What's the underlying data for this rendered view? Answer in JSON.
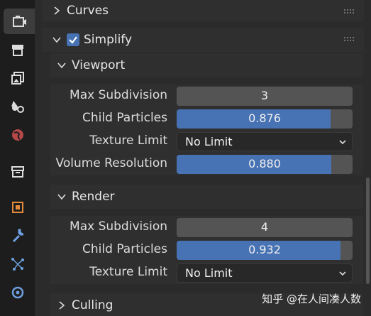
{
  "tabs": [
    {
      "name": "render-properties-tab",
      "active": true
    },
    {
      "name": "output-properties-tab"
    },
    {
      "name": "view-layer-tab"
    },
    {
      "name": "scene-tab"
    },
    {
      "name": "world-tab"
    },
    {
      "name": "collection-tab"
    },
    {
      "name": "object-tab"
    },
    {
      "name": "modifiers-tab"
    },
    {
      "name": "particles-tab"
    },
    {
      "name": "physics-tab"
    }
  ],
  "panels": {
    "curves": {
      "title": "Curves"
    },
    "simplify": {
      "title": "Simplify",
      "enabled": true
    },
    "viewport": {
      "title": "Viewport",
      "max_subdivision": {
        "label": "Max Subdivision",
        "value": "3"
      },
      "child_particles": {
        "label": "Child Particles",
        "value": "0.876",
        "fraction": 0.876
      },
      "texture_limit": {
        "label": "Texture Limit",
        "value": "No Limit"
      },
      "volume_resolution": {
        "label": "Volume Resolution",
        "value": "0.880",
        "fraction": 0.88
      }
    },
    "render": {
      "title": "Render",
      "max_subdivision": {
        "label": "Max Subdivision",
        "value": "4"
      },
      "child_particles": {
        "label": "Child Particles",
        "value": "0.932",
        "fraction": 0.932
      },
      "texture_limit": {
        "label": "Texture Limit",
        "value": "No Limit"
      }
    },
    "culling": {
      "title": "Culling"
    }
  },
  "colors": {
    "accent": "#4772b3",
    "field": "#545454",
    "panel": "#2f2f2f",
    "bg": "#1d1d1d"
  },
  "watermark": "知乎 @在人间凑人数"
}
